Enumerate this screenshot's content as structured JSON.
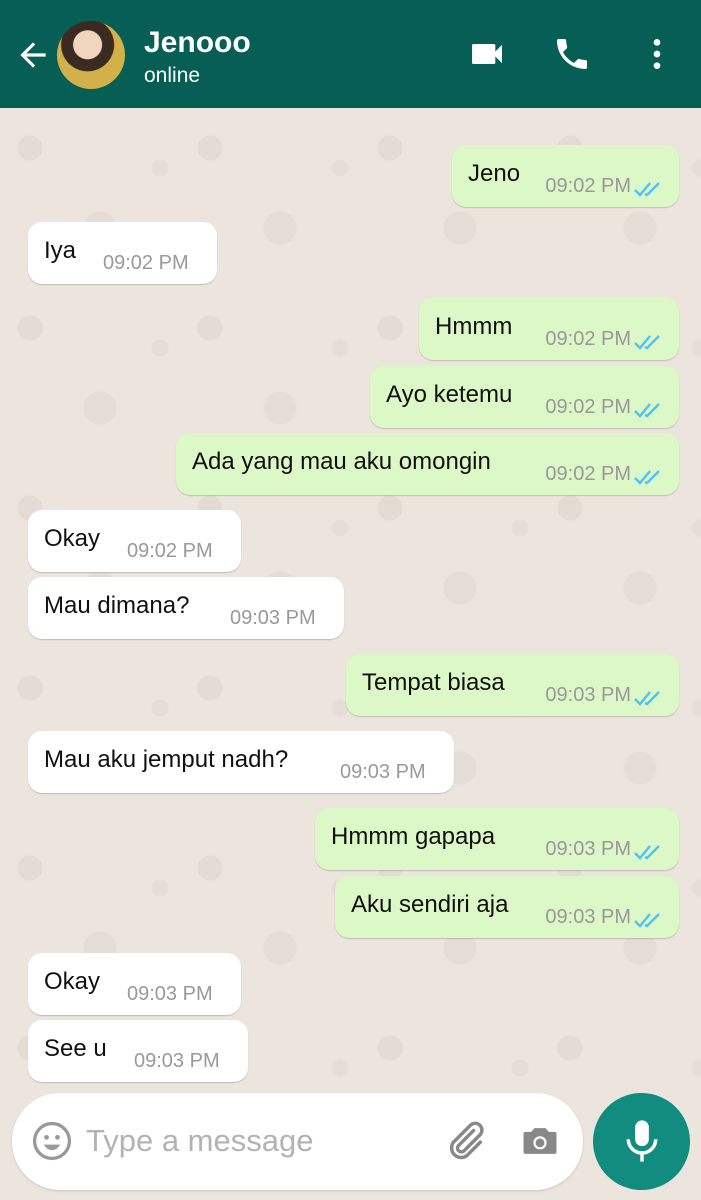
{
  "header": {
    "contact_name": "Jenooo",
    "status": "online"
  },
  "colors": {
    "header": "#075e54",
    "chat_bg": "#ece5dd",
    "outgoing_bubble": "#dcf8c6",
    "incoming_bubble": "#ffffff",
    "read_tick": "#4fc3f7",
    "mic_button": "#128c7e"
  },
  "icons": {
    "back": "arrow-left-icon",
    "video": "video-call-icon",
    "phone": "phone-icon",
    "menu": "more-vertical-icon",
    "emoji": "emoji-icon",
    "attach": "paperclip-icon",
    "camera": "camera-icon",
    "mic": "microphone-icon"
  },
  "messages": [
    {
      "dir": "out",
      "text": "Jeno",
      "time": "09:02 PM",
      "read": true
    },
    {
      "dir": "in",
      "text": "Iya",
      "time": "09:02 PM"
    },
    {
      "dir": "out",
      "text": "Hmmm",
      "time": "09:02 PM",
      "read": true
    },
    {
      "dir": "out",
      "text": "Ayo ketemu",
      "time": "09:02 PM",
      "read": true
    },
    {
      "dir": "out",
      "text": "Ada yang mau aku omongin",
      "time": "09:02 PM",
      "read": true
    },
    {
      "dir": "in",
      "text": "Okay",
      "time": "09:02 PM"
    },
    {
      "dir": "in",
      "text": "Mau dimana?",
      "time": "09:03 PM"
    },
    {
      "dir": "out",
      "text": "Tempat biasa",
      "time": "09:03 PM",
      "read": true
    },
    {
      "dir": "in",
      "text": "Mau aku jemput nadh?",
      "time": "09:03 PM"
    },
    {
      "dir": "out",
      "text": "Hmmm gapapa",
      "time": "09:03 PM",
      "read": true
    },
    {
      "dir": "out",
      "text": "Aku sendiri aja",
      "time": "09:03 PM",
      "read": true
    },
    {
      "dir": "in",
      "text": "Okay",
      "time": "09:03 PM"
    },
    {
      "dir": "in",
      "text": "See u",
      "time": "09:03 PM"
    }
  ],
  "composer": {
    "placeholder": "Type a message"
  }
}
